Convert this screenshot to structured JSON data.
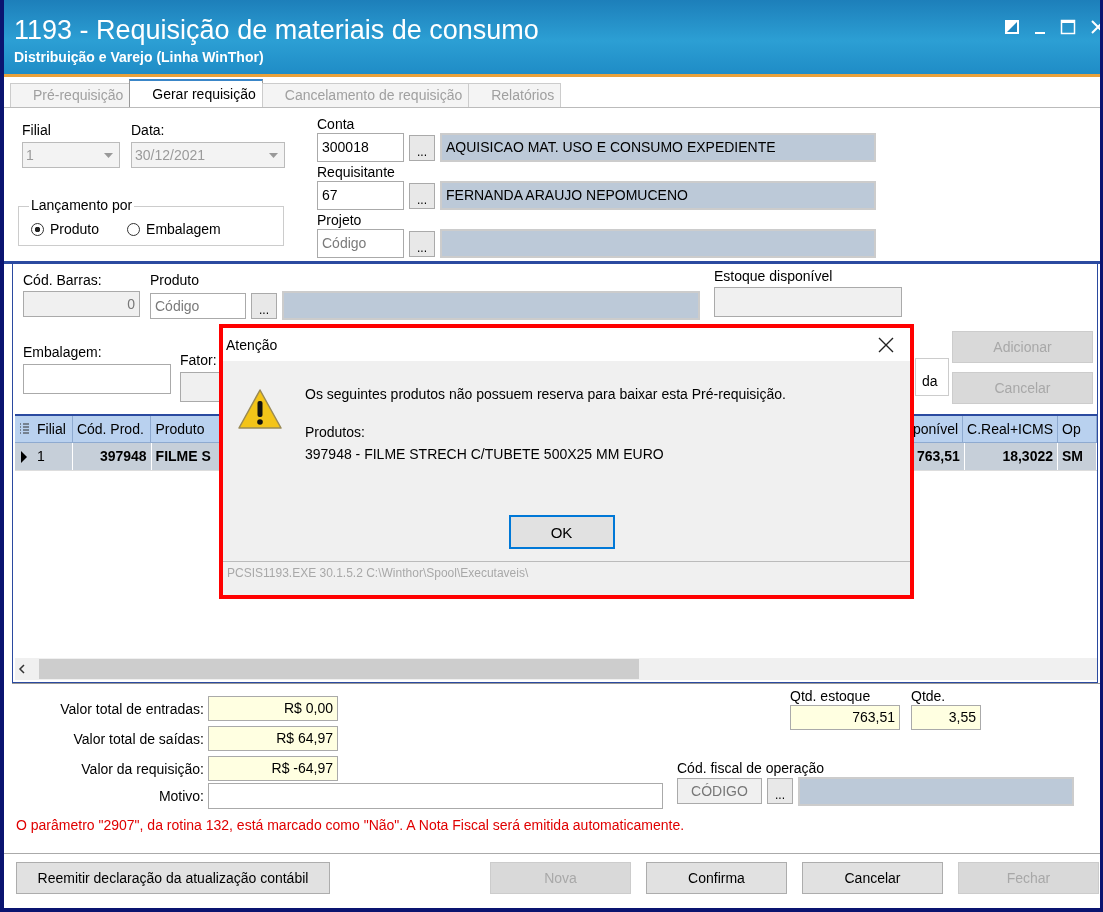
{
  "window": {
    "title": "1193 - Requisição de materiais de consumo",
    "subtitle": "Distribuição e Varejo (Linha WinThor)"
  },
  "tabs": [
    {
      "label": "Pré-requisição",
      "selected": false
    },
    {
      "label": "Gerar requisição",
      "selected": true
    },
    {
      "label": "Cancelamento de requisição",
      "selected": false
    },
    {
      "label": "Relatórios",
      "selected": false
    }
  ],
  "header": {
    "filial": {
      "label": "Filial",
      "value": "1"
    },
    "data": {
      "label": "Data:",
      "value": "30/12/2021"
    },
    "lancamento": {
      "label": "Lançamento por",
      "options": [
        {
          "label": "Produto",
          "selected": true
        },
        {
          "label": "Embalagem",
          "selected": false
        }
      ]
    },
    "conta": {
      "label": "Conta",
      "button": "...",
      "code": "300018",
      "description": "AQUISICAO MAT. USO E CONSUMO EXPEDIENTE"
    },
    "requisitante": {
      "label": "Requisitante",
      "button": "...",
      "code": "67",
      "description": "FERNANDA ARAUJO NEPOMUCENO"
    },
    "projeto": {
      "label": "Projeto",
      "button": "...",
      "placeholder": "Código"
    }
  },
  "product": {
    "cod_barras": {
      "label": "Cód. Barras:",
      "value": "0"
    },
    "produto": {
      "label": "Produto",
      "button": "...",
      "placeholder": "Código"
    },
    "estoque": {
      "label": "Estoque disponível"
    },
    "embalagem": {
      "label": "Embalagem:"
    },
    "fator": {
      "label": "Fator:"
    },
    "partial_text": "da",
    "buttons": [
      {
        "label": "Adicionar",
        "disabled": true
      },
      {
        "label": "Cancelar",
        "disabled": true
      }
    ]
  },
  "grid": {
    "columns": [
      "Filial",
      "Cód. Prod.",
      "Produto",
      "ponível",
      "C.Real+ICMS",
      "Op"
    ],
    "rows": [
      {
        "selected": true,
        "cells": [
          "1",
          "397948",
          "FILME S",
          "763,51",
          "18,3022",
          "SM"
        ]
      }
    ]
  },
  "totals": {
    "fields": [
      {
        "label": "Valor total de entradas:",
        "value": "R$ 0,00"
      },
      {
        "label": "Valor total de saídas:",
        "value": "R$ 64,97"
      },
      {
        "label": "Valor da requisição:",
        "value": "R$ -64,97"
      }
    ],
    "motivo": {
      "label": "Motivo:"
    },
    "qtd_estoque": {
      "label": "Qtd. estoque",
      "value": "763,51"
    },
    "qtde": {
      "label": "Qtde.",
      "value": "3,55"
    },
    "cfop": {
      "label": "Cód. fiscal de operação",
      "button": "...",
      "placeholder": "CÓDIGO"
    },
    "warning": "O parâmetro \"2907\", da rotina 132, está marcado como \"Não\". A Nota Fiscal será emitida automaticamente."
  },
  "footer_buttons": [
    {
      "label": "Reemitir declaração da atualização contábil",
      "disabled": false
    },
    {
      "label": "Nova",
      "disabled": true
    },
    {
      "label": "Confirma",
      "disabled": false
    },
    {
      "label": "Cancelar",
      "disabled": false
    },
    {
      "label": "Fechar",
      "disabled": true
    }
  ],
  "dialog": {
    "title": "Atenção",
    "message": "Os seguintes produtos não possuem reserva para baixar esta Pré-requisição.",
    "products_label": "Produtos:",
    "product_line": "397948 - FILME STRECH C/TUBETE 500X25 MM EURO",
    "ok": "OK",
    "status": "PCSIS1193.EXE 30.1.5.2 C:\\Winthor\\Spool\\Executaveis\\"
  }
}
